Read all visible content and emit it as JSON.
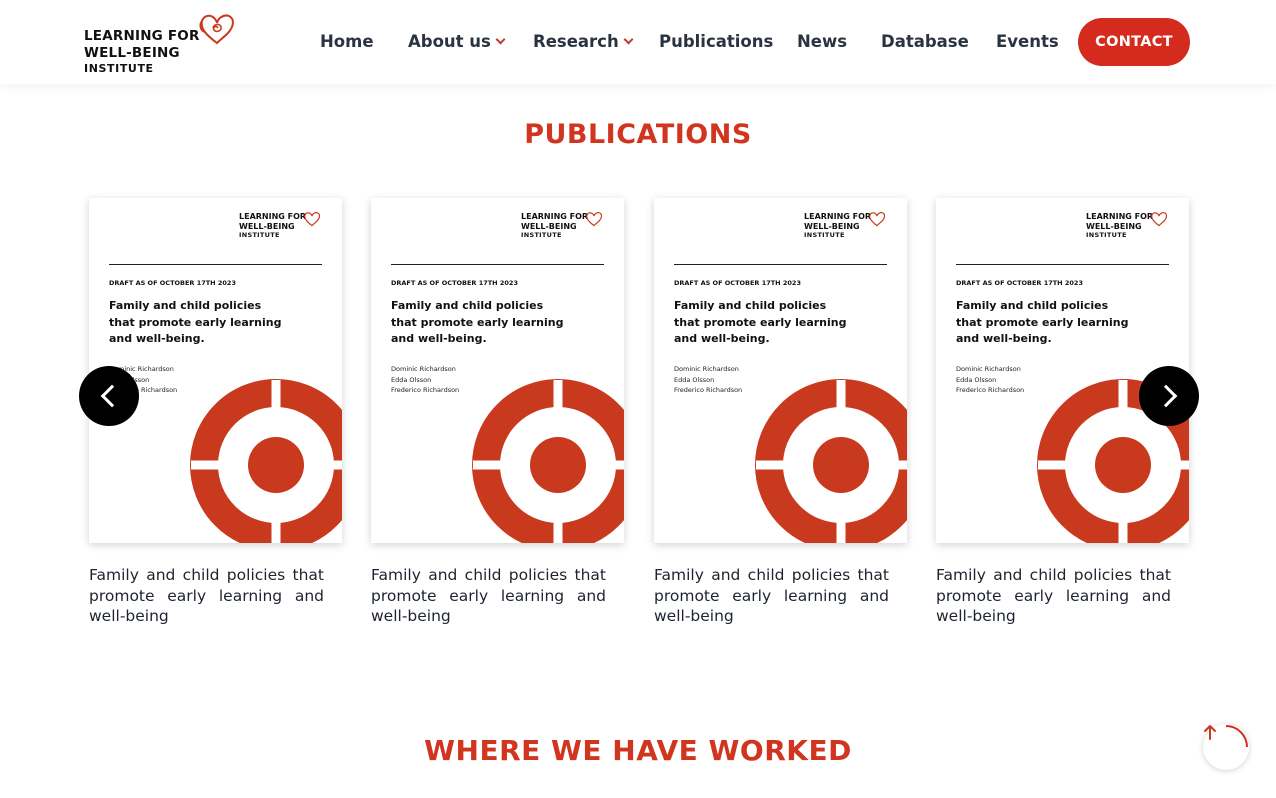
{
  "header": {
    "logo": {
      "line1": "LEARNING FOR",
      "line2": "WELL-BEING",
      "line3": "INSTITUTE"
    },
    "nav": [
      {
        "label": "Home",
        "has_dropdown": false
      },
      {
        "label": "About us",
        "has_dropdown": true
      },
      {
        "label": "Research",
        "has_dropdown": true
      },
      {
        "label": "Publications",
        "has_dropdown": false
      },
      {
        "label": "News",
        "has_dropdown": false
      },
      {
        "label": "Database",
        "has_dropdown": false
      },
      {
        "label": "Events",
        "has_dropdown": false
      }
    ],
    "contact_label": "CONTACT"
  },
  "publications": {
    "title": "PUBLICATIONS",
    "cards": [
      {
        "cover_logo": {
          "line1": "LEARNING FOR",
          "line2": "WELL-BEING",
          "line3": "INSTITUTE"
        },
        "draft_label": "DRAFT AS OF OCTOBER 17TH 2023",
        "cover_title": "Family and child policies that promote early learning and well-being.",
        "authors": [
          "Dominic Richardson",
          "Edda Olsson",
          "Frederico Richardson"
        ],
        "caption": "Family and child policies that promote early learning and well-being"
      },
      {
        "cover_logo": {
          "line1": "LEARNING FOR",
          "line2": "WELL-BEING",
          "line3": "INSTITUTE"
        },
        "draft_label": "DRAFT AS OF OCTOBER 17TH 2023",
        "cover_title": "Family and child policies that promote early learning and well-being.",
        "authors": [
          "Dominic Richardson",
          "Edda Olsson",
          "Frederico Richardson"
        ],
        "caption": "Family and child policies that promote early learning and well-being"
      },
      {
        "cover_logo": {
          "line1": "LEARNING FOR",
          "line2": "WELL-BEING",
          "line3": "INSTITUTE"
        },
        "draft_label": "DRAFT AS OF OCTOBER 17TH 2023",
        "cover_title": "Family and child policies that promote early learning and well-being.",
        "authors": [
          "Dominic Richardson",
          "Edda Olsson",
          "Frederico Richardson"
        ],
        "caption": "Family and child policies that promote early learning and well-being"
      },
      {
        "cover_logo": {
          "line1": "LEARNING FOR",
          "line2": "WELL-BEING",
          "line3": "INSTITUTE"
        },
        "draft_label": "DRAFT AS OF OCTOBER 17TH 2023",
        "cover_title": "Family and child policies that promote early learning and well-being.",
        "authors": [
          "Dominic Richardson",
          "Edda Olsson",
          "Frederico Richardson"
        ],
        "caption": "Family and child policies that promote early learning and well-being"
      }
    ]
  },
  "where_we_worked": {
    "title": "WHERE WE HAVE WORKED"
  },
  "icons": {
    "prev": "chevron-left-icon",
    "next": "chevron-right-icon",
    "back_to_top": "arrow-up-icon",
    "brand": "heart-logo-icon"
  },
  "colors": {
    "accent": "#d52b1e",
    "title_red": "#d1341f",
    "ring_red": "#c9391e",
    "text_dark": "#2a3340"
  }
}
